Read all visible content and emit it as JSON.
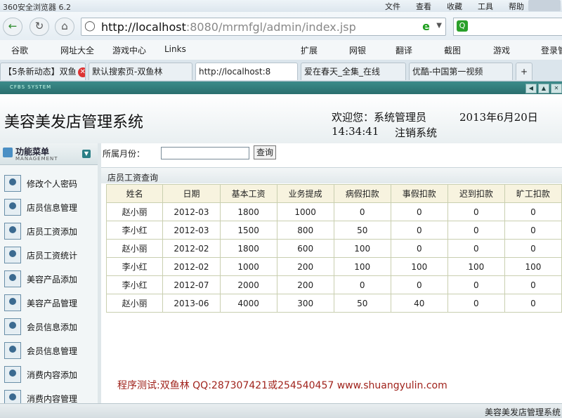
{
  "browser": {
    "title": "360安全浏览器 6.2",
    "menu": [
      "文件",
      "查看",
      "收藏",
      "工具",
      "帮助"
    ],
    "url_host": "http://localhost",
    "url_rest": ":8080/mrmfgl/admin/index.jsp",
    "favorites": [
      "谷歌",
      "网址大全",
      "游戏中心",
      "Links",
      "扩展",
      "网银",
      "翻译",
      "截图",
      "游戏",
      "登录管"
    ],
    "tabs": [
      "【5条新动态】双鱼",
      "默认搜索页-双鱼林",
      "http://localhost:8",
      "爱在春天_全集_在线",
      "优酷-中国第一视频"
    ]
  },
  "app": {
    "strip_label": "CFBS SYSTEM",
    "title": "美容美发店管理系统",
    "welcome": "欢迎您：系统管理员",
    "date": "2013年6月20日",
    "time": "14:34:41",
    "logout": "注销系统"
  },
  "sidebar": {
    "header": "功能菜单",
    "header_sub": "MANAGEMENT",
    "items": [
      "修改个人密码",
      "店员信息管理",
      "店员工资添加",
      "店员工资统计",
      "美容产品添加",
      "美容产品管理",
      "会员信息添加",
      "会员信息管理",
      "消费内容添加",
      "消费内容管理"
    ]
  },
  "filter": {
    "label": "所属月份：",
    "value": "",
    "button": "查询"
  },
  "section_title": "店员工资查询",
  "table": {
    "headers": [
      "姓名",
      "日期",
      "基本工资",
      "业务提成",
      "病假扣款",
      "事假扣款",
      "迟到扣款",
      "旷工扣款"
    ],
    "rows": [
      [
        "赵小丽",
        "2012-03",
        "1800",
        "1000",
        "0",
        "0",
        "0",
        "0"
      ],
      [
        "李小红",
        "2012-03",
        "1500",
        "800",
        "50",
        "0",
        "0",
        "0"
      ],
      [
        "赵小丽",
        "2012-02",
        "1800",
        "600",
        "100",
        "0",
        "0",
        "0"
      ],
      [
        "李小红",
        "2012-02",
        "1000",
        "200",
        "100",
        "100",
        "100",
        "100"
      ],
      [
        "李小红",
        "2012-07",
        "2000",
        "200",
        "0",
        "0",
        "0",
        "0"
      ],
      [
        "赵小丽",
        "2013-06",
        "4000",
        "300",
        "50",
        "40",
        "0",
        "0"
      ]
    ]
  },
  "footer_text": "程序测试:双鱼林 QQ:287307421或254540457 www.shuangyulin.com",
  "status_text": "美容美发店管理系统"
}
